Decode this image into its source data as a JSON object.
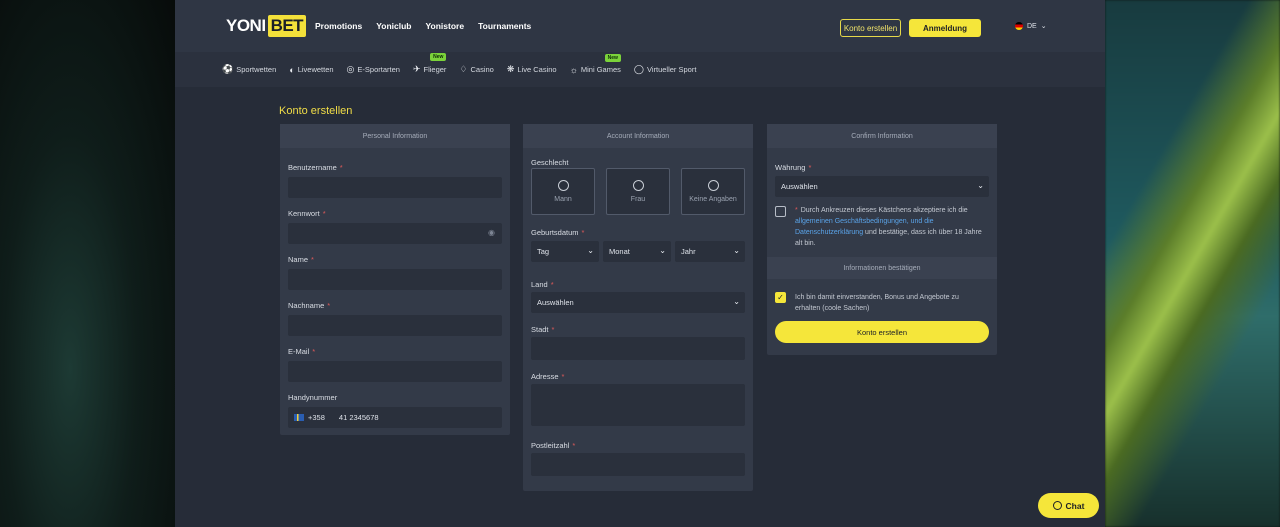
{
  "header": {
    "logo_left": "YONI",
    "logo_right": "BET",
    "nav": [
      "Promotions",
      "Yoniclub",
      "Yonistore",
      "Tournaments"
    ],
    "register_label": "Konto erstellen",
    "login_label": "Anmeldung",
    "lang": "DE"
  },
  "subnav": [
    {
      "label": "Sportwetten",
      "icon": "soccer-ball-icon"
    },
    {
      "label": "Livewetten",
      "icon": "live-icon"
    },
    {
      "label": "E-Sportarten",
      "icon": "esports-icon"
    },
    {
      "label": "Flieger",
      "icon": "plane-icon",
      "badge": "New"
    },
    {
      "label": "Casino",
      "icon": "casino-icon"
    },
    {
      "label": "Live Casino",
      "icon": "live-casino-icon"
    },
    {
      "label": "Mini Games",
      "icon": "gamepad-icon",
      "badge": "New"
    },
    {
      "label": "Virtueller Sport",
      "icon": "virtual-sport-icon"
    }
  ],
  "page": {
    "title": "Konto erstellen"
  },
  "personal": {
    "heading": "Personal Information",
    "username_label": "Benutzername",
    "password_label": "Kennwort",
    "name_label": "Name",
    "lastname_label": "Nachname",
    "email_label": "E-Mail",
    "phone_label": "Handynummer",
    "phone_code": "+358",
    "phone_value": "41 2345678"
  },
  "account": {
    "heading": "Account Information",
    "gender_label": "Geschlecht",
    "gender_options": [
      "Mann",
      "Frau",
      "Keine Angaben"
    ],
    "birth_label": "Geburtsdatum",
    "day": "Tag",
    "month": "Monat",
    "year": "Jahr",
    "country_label": "Land",
    "country_value": "Auswählen",
    "city_label": "Stadt",
    "address_label": "Adresse",
    "zip_label": "Postleitzahl"
  },
  "confirm": {
    "heading": "Confirm Information",
    "currency_label": "Währung",
    "currency_value": "Auswählen",
    "terms_before": "Durch Ankreuzen dieses Kästchens akzeptiere ich die",
    "terms_link1": "allgemeinen Geschäftsbedingungen",
    "terms_mid": ", und die",
    "terms_link2": "Datenschutzerklärung",
    "terms_after": "und bestätige, dass ich über 18 Jahre alt bin.",
    "sub_heading": "Informationen bestätigen",
    "bonus_text": "Ich bin damit einverstanden, Bonus und Angebote zu erhalten (coole Sachen)",
    "submit_label": "Konto erstellen"
  },
  "chat_label": "Chat",
  "colors": {
    "accent": "#f5e63a",
    "title": "#f1dd47",
    "link": "#5aa3e8",
    "required": "#e05a5a"
  }
}
